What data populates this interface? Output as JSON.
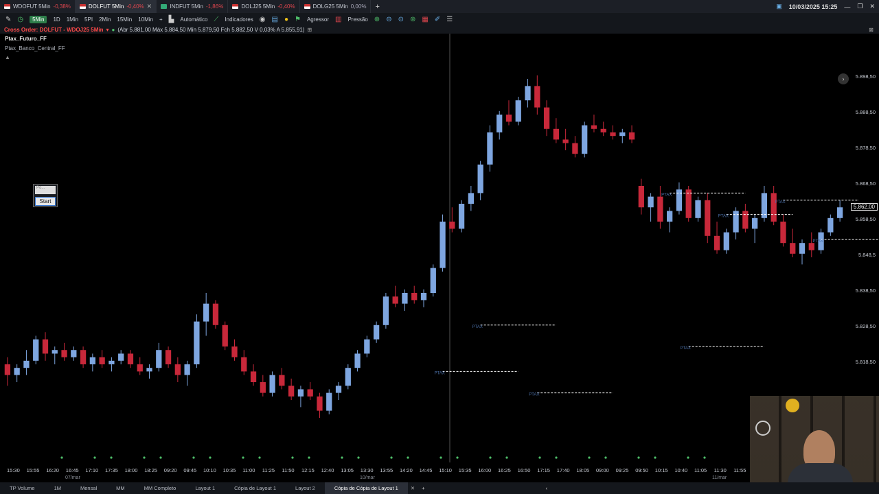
{
  "tabs": [
    {
      "symbol": "WDOFUT 5Min",
      "change": "-0,38%",
      "cls": "neg",
      "flag": "red"
    },
    {
      "symbol": "DOLFUT 5Min",
      "change": "-0,40%",
      "cls": "neg",
      "flag": "red",
      "active": true
    },
    {
      "symbol": "INDFUT 5Min",
      "change": "-1,86%",
      "cls": "neg",
      "flag": "green"
    },
    {
      "symbol": "DOLJ25 5Min",
      "change": "-0,40%",
      "cls": "neg",
      "flag": "red"
    },
    {
      "symbol": "DOLG25 5Min",
      "change": "0,00%",
      "cls": "zero",
      "flag": "red"
    }
  ],
  "datetime": "10/03/2025 15:25",
  "toolbar": {
    "timeframes": [
      "5Min",
      "1D",
      "1Min",
      "5PI",
      "2Min",
      "15Min",
      "10Min"
    ],
    "automatico": "Automático",
    "indicadores": "Indicadores",
    "agressor": "Agressor",
    "pressao": "Pressão"
  },
  "infobar": {
    "cross": "Cross Order: DOLFUT - WDOJ25 5Min",
    "ohlc": "(Abr 5.881,00 Máx 5.884,50 Mín 5.879,50 Fch 5.882,50 V 0,03% A 5.855,91)"
  },
  "indicators": [
    "Ptax_Futuro_FF",
    "Ptax_Banco_Central_FF"
  ],
  "start_widget": {
    "label": "Start",
    "placeholder": "Po..."
  },
  "price_axis": [
    "5.898,50",
    "5.888,50",
    "5.878,50",
    "5.868,50",
    "5.858,50",
    "5.848,5",
    "5.838,50",
    "5.828,50",
    "5.818,50",
    "5.808,50"
  ],
  "current_price": "5.862,00",
  "time_axis": [
    "15:30",
    "15:55",
    "16:20",
    "16:45",
    "17:10",
    "17:35",
    "18:00",
    "18:25",
    "09:20",
    "09:45",
    "10:10",
    "10:35",
    "11:00",
    "11:25",
    "11:50",
    "12:15",
    "12:40",
    "13:05",
    "13:30",
    "13:55",
    "14:20",
    "14:45",
    "15:10",
    "15:35",
    "16:00",
    "16:25",
    "16:50",
    "17:15",
    "17:40",
    "18:05",
    "09:00",
    "09:25",
    "09:50",
    "10:15",
    "10:40",
    "11:05",
    "11:30",
    "11:55"
  ],
  "date_axis": [
    "07/mar",
    "10/mar",
    "11/mar"
  ],
  "ptax_label": "PTAX",
  "bottom_tabs": [
    "TP Volume",
    "1M",
    "Mensal",
    "MM",
    "MM Completo",
    "Layout 1",
    "Cópia de Layout 1",
    "Layout 2",
    "Cópia de Cópia de Layout 1"
  ],
  "colors": {
    "up": "#7ea6e0",
    "down": "#c8283a",
    "accent": "#2e7d4a"
  },
  "chart_data": {
    "type": "candlestick",
    "ylim": [
      5803,
      5903
    ],
    "candles": [
      [
        5818,
        5820,
        5812,
        5815
      ],
      [
        5815,
        5818,
        5813,
        5817
      ],
      [
        5817,
        5822,
        5815,
        5819
      ],
      [
        5819,
        5826,
        5818,
        5825
      ],
      [
        5825,
        5827,
        5819,
        5821
      ],
      [
        5821,
        5823,
        5818,
        5822
      ],
      [
        5822,
        5824,
        5819,
        5820
      ],
      [
        5820,
        5823,
        5819,
        5822
      ],
      [
        5822,
        5823,
        5817,
        5818
      ],
      [
        5818,
        5821,
        5816,
        5820
      ],
      [
        5820,
        5822,
        5817,
        5818
      ],
      [
        5818,
        5820,
        5816,
        5819
      ],
      [
        5819,
        5822,
        5818,
        5821
      ],
      [
        5821,
        5822,
        5817,
        5818
      ],
      [
        5818,
        5820,
        5815,
        5816
      ],
      [
        5816,
        5818,
        5814,
        5817
      ],
      [
        5817,
        5824,
        5816,
        5822
      ],
      [
        5822,
        5823,
        5817,
        5818
      ],
      [
        5818,
        5820,
        5813,
        5815
      ],
      [
        5815,
        5819,
        5812,
        5818
      ],
      [
        5818,
        5832,
        5817,
        5830
      ],
      [
        5830,
        5838,
        5826,
        5835
      ],
      [
        5835,
        5836,
        5828,
        5829
      ],
      [
        5829,
        5830,
        5822,
        5823
      ],
      [
        5823,
        5825,
        5819,
        5820
      ],
      [
        5820,
        5822,
        5815,
        5816
      ],
      [
        5816,
        5818,
        5812,
        5813
      ],
      [
        5813,
        5815,
        5809,
        5810
      ],
      [
        5810,
        5816,
        5809,
        5815
      ],
      [
        5815,
        5817,
        5811,
        5812
      ],
      [
        5812,
        5814,
        5808,
        5809
      ],
      [
        5809,
        5812,
        5806,
        5811
      ],
      [
        5811,
        5813,
        5808,
        5809
      ],
      [
        5809,
        5810,
        5803,
        5805
      ],
      [
        5805,
        5811,
        5804,
        5810
      ],
      [
        5810,
        5813,
        5808,
        5812
      ],
      [
        5812,
        5818,
        5811,
        5817
      ],
      [
        5817,
        5822,
        5816,
        5821
      ],
      [
        5821,
        5826,
        5820,
        5825
      ],
      [
        5825,
        5830,
        5824,
        5829
      ],
      [
        5829,
        5838,
        5828,
        5837
      ],
      [
        5837,
        5840,
        5834,
        5835
      ],
      [
        5835,
        5839,
        5833,
        5838
      ],
      [
        5838,
        5840,
        5835,
        5836
      ],
      [
        5836,
        5839,
        5834,
        5838
      ],
      [
        5838,
        5846,
        5837,
        5845
      ],
      [
        5845,
        5860,
        5844,
        5858
      ],
      [
        5858,
        5862,
        5855,
        5856
      ],
      [
        5856,
        5864,
        5855,
        5863
      ],
      [
        5863,
        5868,
        5861,
        5866
      ],
      [
        5866,
        5875,
        5864,
        5874
      ],
      [
        5874,
        5885,
        5872,
        5883
      ],
      [
        5883,
        5889,
        5881,
        5888
      ],
      [
        5888,
        5892,
        5885,
        5886
      ],
      [
        5886,
        5893,
        5885,
        5892
      ],
      [
        5892,
        5898,
        5890,
        5896
      ],
      [
        5896,
        5899,
        5888,
        5890
      ],
      [
        5890,
        5892,
        5882,
        5884
      ],
      [
        5884,
        5887,
        5880,
        5881
      ],
      [
        5881,
        5884,
        5878,
        5880
      ],
      [
        5880,
        5882,
        5876,
        5877
      ],
      [
        5877,
        5886,
        5876,
        5885
      ],
      [
        5885,
        5888,
        5883,
        5884
      ],
      [
        5884,
        5886,
        5882,
        5883
      ],
      [
        5883,
        5885,
        5881,
        5882
      ],
      [
        5882,
        5884,
        5880,
        5883
      ],
      [
        5883,
        5885,
        5880,
        5881
      ],
      [
        5868,
        5870,
        5860,
        5862
      ],
      [
        5862,
        5866,
        5858,
        5865
      ],
      [
        5865,
        5868,
        5856,
        5858
      ],
      [
        5858,
        5862,
        5855,
        5861
      ],
      [
        5861,
        5869,
        5860,
        5867
      ],
      [
        5867,
        5868,
        5858,
        5859
      ],
      [
        5859,
        5865,
        5858,
        5864
      ],
      [
        5864,
        5866,
        5852,
        5854
      ],
      [
        5854,
        5858,
        5849,
        5850
      ],
      [
        5850,
        5856,
        5849,
        5855
      ],
      [
        5855,
        5862,
        5853,
        5861
      ],
      [
        5861,
        5863,
        5855,
        5856
      ],
      [
        5856,
        5860,
        5852,
        5859
      ],
      [
        5859,
        5868,
        5858,
        5866
      ],
      [
        5866,
        5868,
        5857,
        5858
      ],
      [
        5858,
        5860,
        5851,
        5852
      ],
      [
        5852,
        5856,
        5848,
        5849
      ],
      [
        5849,
        5853,
        5846,
        5852
      ],
      [
        5852,
        5855,
        5848,
        5850
      ],
      [
        5850,
        5856,
        5849,
        5855
      ],
      [
        5855,
        5860,
        5854,
        5859
      ],
      [
        5859,
        5864,
        5858,
        5862
      ]
    ],
    "ptax_levels": [
      {
        "price": 5829,
        "from": 50,
        "to": 58
      },
      {
        "price": 5823,
        "from": 72,
        "to": 80
      },
      {
        "price": 5816,
        "from": 46,
        "to": 54
      },
      {
        "price": 5810,
        "from": 56,
        "to": 64
      },
      {
        "price": 5866,
        "from": 70,
        "to": 78
      },
      {
        "price": 5860,
        "from": 76,
        "to": 83
      },
      {
        "price": 5864,
        "from": 82,
        "to": 90
      },
      {
        "price": 5853,
        "from": 86,
        "to": 93
      }
    ]
  }
}
